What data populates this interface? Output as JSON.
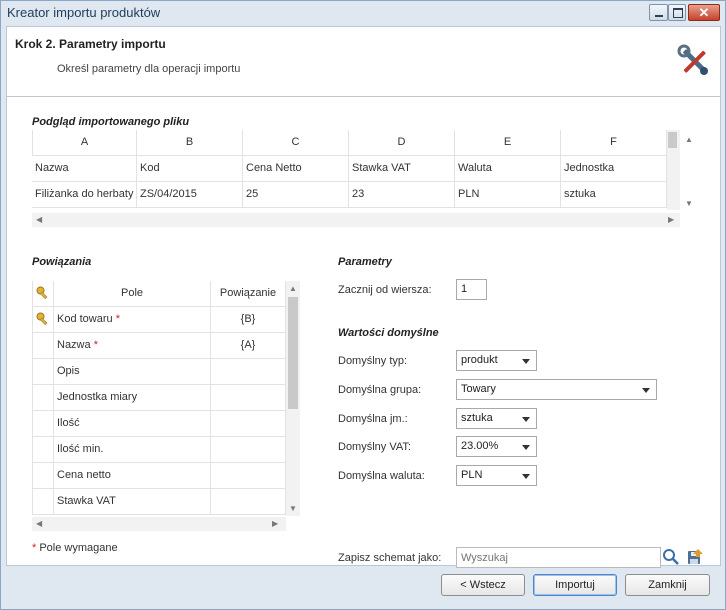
{
  "window": {
    "title": "Kreator importu produktów",
    "close_glyph": "✕"
  },
  "header": {
    "title": "Krok 2. Parametry importu",
    "subtitle": "Określ parametry dla operacji importu",
    "icon": "tools-icon"
  },
  "preview": {
    "title": "Podgląd importowanego pliku",
    "columns": [
      "A",
      "B",
      "C",
      "D",
      "E",
      "F"
    ],
    "rows": [
      [
        "Nazwa",
        "Kod",
        "Cena Netto",
        "Stawka VAT",
        "Waluta",
        "Jednostka"
      ],
      [
        "Filiżanka do herbaty",
        "ZS/04/2015",
        "25",
        "23",
        "PLN",
        "sztuka"
      ]
    ]
  },
  "mapping": {
    "title": "Powiązania",
    "col_field": "Pole",
    "col_link": "Powiązanie",
    "rows": [
      {
        "field": "Kod towaru",
        "required": "*",
        "link": "{B}",
        "key": true
      },
      {
        "field": "Nazwa",
        "required": "*",
        "link": "{A}",
        "key": false
      },
      {
        "field": "Opis",
        "required": "",
        "link": "",
        "key": false
      },
      {
        "field": "Jednostka miary",
        "required": "",
        "link": "",
        "key": false
      },
      {
        "field": "Ilość",
        "required": "",
        "link": "",
        "key": false
      },
      {
        "field": "Ilość min.",
        "required": "",
        "link": "",
        "key": false
      },
      {
        "field": "Cena netto",
        "required": "",
        "link": "",
        "key": false
      },
      {
        "field": "Stawka VAT",
        "required": "",
        "link": "",
        "key": false
      }
    ],
    "required_note_star": "*",
    "required_note": "Pole wymagane"
  },
  "params": {
    "title": "Parametry",
    "start_row_label": "Zacznij od wiersza:",
    "start_row_value": "1",
    "defaults_title": "Wartości domyślne",
    "type_label": "Domyślny typ:",
    "type_value": "produkt",
    "group_label": "Domyślna grupa:",
    "group_value": "Towary",
    "unit_label": "Domyślna jm.:",
    "unit_value": "sztuka",
    "vat_label": "Domyślny VAT:",
    "vat_value": "23.00%",
    "currency_label": "Domyślna waluta:",
    "currency_value": "PLN"
  },
  "schema": {
    "label": "Zapisz schemat jako:",
    "placeholder": "Wyszukaj"
  },
  "buttons": {
    "back": "< Wstecz",
    "import": "Importuj",
    "close": "Zamknij"
  }
}
